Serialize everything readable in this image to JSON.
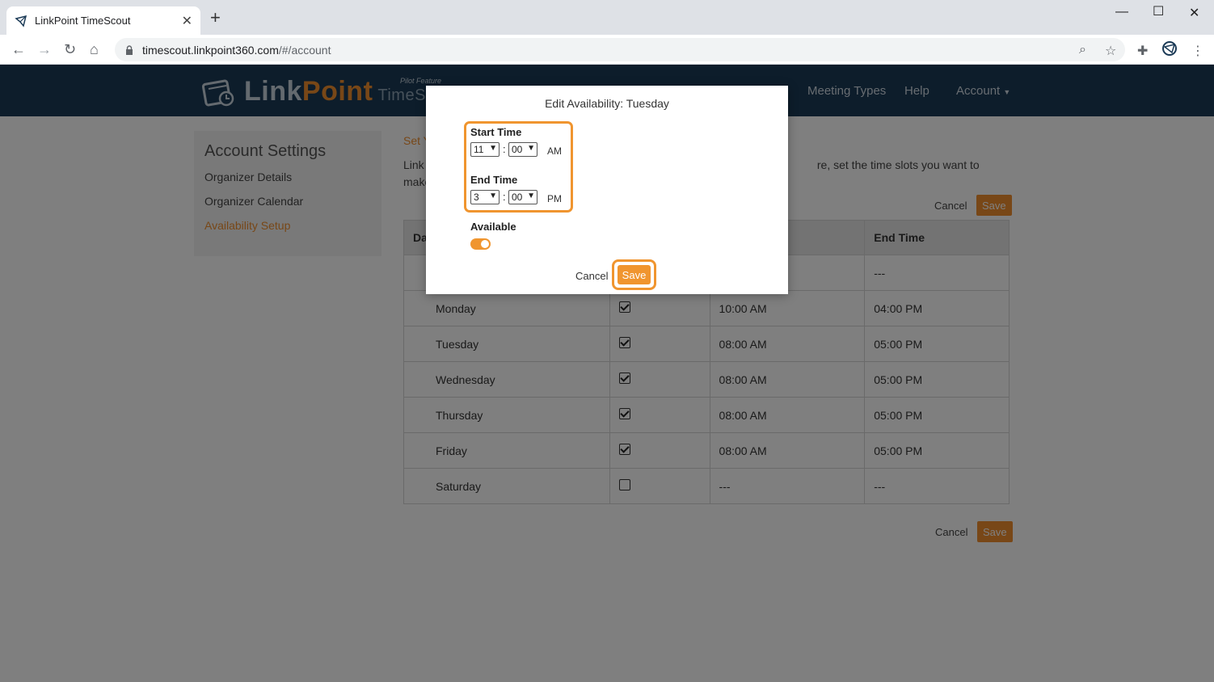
{
  "browser": {
    "tab_title": "LinkPoint TimeScout",
    "url_host": "timescout.linkpoint360.com",
    "url_path": "/#/account"
  },
  "header": {
    "logo_link": "Link",
    "logo_point": "Point",
    "logo_product": "TimeSco",
    "pilot_label": "Pilot Feature",
    "nav": [
      "Meeting Types",
      "Help",
      "Account"
    ]
  },
  "sidebar": {
    "title": "Account Settings",
    "items": [
      {
        "label": "Organizer Details"
      },
      {
        "label": "Organizer Calendar"
      },
      {
        "label": "Availability Setup"
      }
    ]
  },
  "content": {
    "section_title": "Set Y",
    "description": "Link                                                                                                                             re, set the time slots you want to make avail",
    "cancel_label": "Cancel",
    "save_label": "Save",
    "table": {
      "headers": [
        "Day",
        "",
        "",
        "End Time"
      ],
      "rows": [
        {
          "day": "",
          "available": false,
          "start": "",
          "end": "---"
        },
        {
          "day": "Monday",
          "available": true,
          "start": "10:00 AM",
          "end": "04:00 PM"
        },
        {
          "day": "Tuesday",
          "available": true,
          "start": "08:00 AM",
          "end": "05:00 PM"
        },
        {
          "day": "Wednesday",
          "available": true,
          "start": "08:00 AM",
          "end": "05:00 PM"
        },
        {
          "day": "Thursday",
          "available": true,
          "start": "08:00 AM",
          "end": "05:00 PM"
        },
        {
          "day": "Friday",
          "available": true,
          "start": "08:00 AM",
          "end": "05:00 PM"
        },
        {
          "day": "Saturday",
          "available": false,
          "start": "---",
          "end": "---"
        }
      ]
    }
  },
  "modal": {
    "title": "Edit Availability: Tuesday",
    "start_label": "Start Time",
    "start_hour": "11",
    "start_minute": "00",
    "start_ampm": "AM",
    "end_label": "End Time",
    "end_hour": "3",
    "end_minute": "00",
    "end_ampm": "PM",
    "colon": ":",
    "available_label": "Available",
    "available_on": true,
    "cancel_label": "Cancel",
    "save_label": "Save"
  },
  "colors": {
    "accent": "#f08f2f",
    "header_bg": "#1b3a56"
  }
}
